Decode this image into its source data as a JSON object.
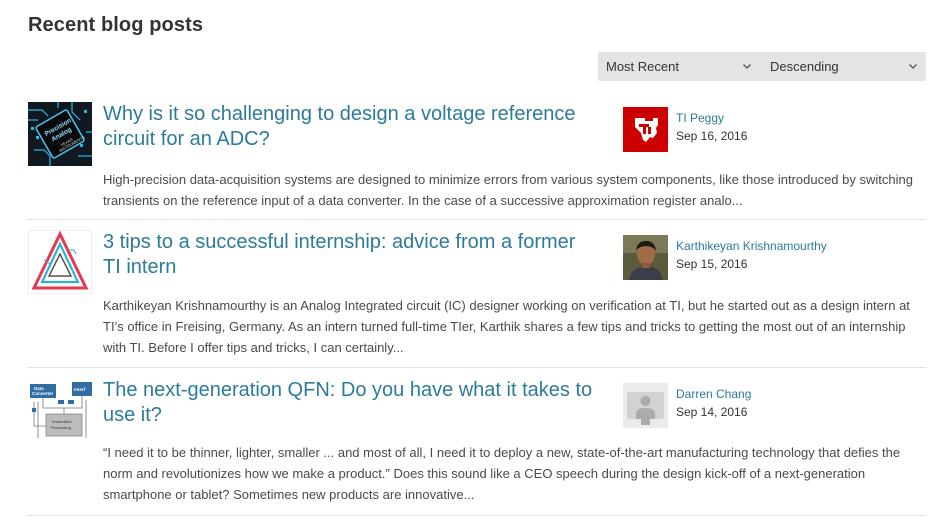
{
  "page": {
    "title": "Recent blog posts"
  },
  "sort": {
    "sort_by": "Most Recent",
    "order": "Descending"
  },
  "colors": {
    "link": "#2c7b9a",
    "text": "#333333",
    "select_bg": "#e4e4e4",
    "divider": "#e0e0e0",
    "ti_red": "#cc0000"
  },
  "posts": [
    {
      "title": "Why is it so challenging to design a voltage reference circuit for an ADC?",
      "author": "TI Peggy",
      "date": "Sep 16, 2016",
      "thumbnail_icon": "precision-analog-chip-image",
      "avatar_icon": "ti-logo-icon",
      "excerpt": "High-precision data-acquisition systems are designed to minimize errors from various system components, like those introduced by switching transients on the reference input of a data converter. In the case of a successive approximation register analo..."
    },
    {
      "title": "3 tips to a successful internship: advice from a former TI intern",
      "author": "Karthikeyan Krishnamourthy",
      "date": "Sep 15, 2016",
      "thumbnail_icon": "triangle-circuit-image",
      "avatar_icon": "user-photo",
      "excerpt": "Karthikeyan Krishnamourthy is an Analog Integrated circuit (IC) designer working on verification at TI, but he started out as a design intern at TI’s office in Freising, Germany. As an intern turned full-time TIer, Karthik shares a few tips and tricks to getting the most out of an internship with TI. Before I offer tips and tricks, I can certainly..."
    },
    {
      "title": "The next-generation QFN: Do you have what it takes to use it?",
      "author": "Darren Chang",
      "date": "Sep 14, 2016",
      "thumbnail_icon": "block-diagram-image",
      "avatar_icon": "default-avatar-icon",
      "excerpt": "“I need it to be thinner, lighter, smaller ... and most of all, I need it to deploy a new, state-of-the-art manufacturing technology that defies the norm and revolutionizes how we make a product.” Does this sound like a CEO speech during the design kick-off of a next-generation smartphone or tablet? Sometimes new products are innovative..."
    }
  ]
}
